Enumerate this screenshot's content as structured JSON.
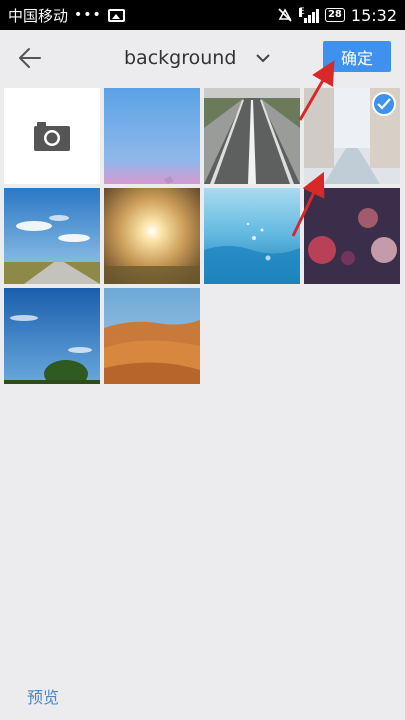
{
  "status_bar": {
    "carrier": "中国移动",
    "dots": "•••",
    "network": "E",
    "battery": "28",
    "time": "15:32"
  },
  "header": {
    "album_title": "background",
    "confirm_label": "确定"
  },
  "grid": {
    "items": [
      {
        "type": "camera",
        "icon": "camera-icon"
      },
      {
        "type": "photo",
        "subject": "blue-pink-sky",
        "selected": false
      },
      {
        "type": "photo",
        "subject": "empty-road",
        "selected": false
      },
      {
        "type": "photo",
        "subject": "city-street-faded",
        "selected": true
      },
      {
        "type": "photo",
        "subject": "road-through-field",
        "selected": false
      },
      {
        "type": "photo",
        "subject": "sunburst-bokeh",
        "selected": false
      },
      {
        "type": "photo",
        "subject": "water-droplets",
        "selected": false
      },
      {
        "type": "photo",
        "subject": "red-bokeh-lights",
        "selected": false
      },
      {
        "type": "photo",
        "subject": "tree-blue-sky",
        "selected": false
      },
      {
        "type": "photo",
        "subject": "desert-dunes",
        "selected": false
      }
    ]
  },
  "footer": {
    "preview_label": "预览"
  },
  "colors": {
    "accent": "#3e92ed",
    "background": "#ecebee",
    "annotation_arrow": "#d9282a"
  }
}
